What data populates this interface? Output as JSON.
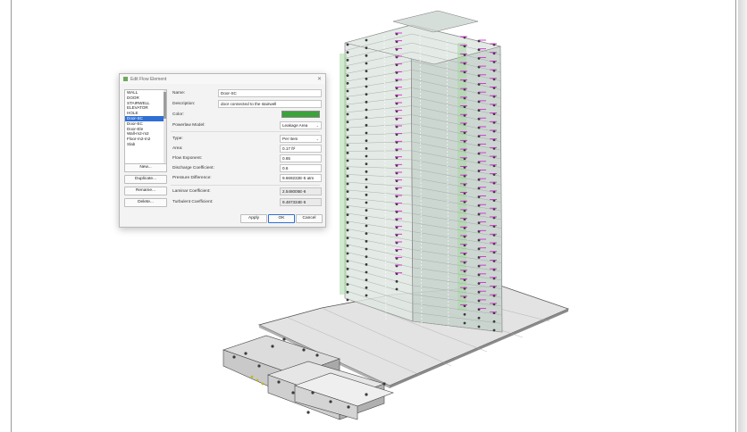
{
  "window": {
    "title": "Edit Flow Element"
  },
  "element_list": {
    "items": [
      "WALL",
      "DOOR",
      "STAIRWELL",
      "ELEVATOR",
      "HOLE",
      "Door-SC",
      "Door-EC",
      "Door-Ele",
      "Wall-m2-m2",
      "Floor-m2-m2",
      "Slab"
    ],
    "selected_index": 5
  },
  "buttons": {
    "new": "New...",
    "duplicate": "Duplicate...",
    "rename": "Rename...",
    "delete": "Delete...",
    "apply": "Apply",
    "ok": "OK",
    "cancel": "Cancel"
  },
  "form": {
    "name_label": "Name:",
    "name_value": "Door-SC",
    "description_label": "Description:",
    "description_value": "door connected to the stairwell",
    "color_label": "Color:",
    "color_value": "#3aa33a",
    "powerlaw_label": "Powerlaw Model:",
    "powerlaw_value": "Leakage Area",
    "type_label": "Type:",
    "type_value": "Per Item",
    "area_label": "Area:",
    "area_value": "0.17 ft²",
    "flow_exp_label": "Flow Exponent:",
    "flow_exp_value": "0.65",
    "discharge_label": "Discharge Coefficient:",
    "discharge_value": "0.6",
    "pressure_label": "Pressure Difference:",
    "pressure_value": "9.669232E-5 atm",
    "laminar_label": "Laminar Coefficient:",
    "laminar_value": "2.548005E-6",
    "turbulent_label": "Turbulent Coefficient:",
    "turbulent_value": "9.487334E-5"
  }
}
